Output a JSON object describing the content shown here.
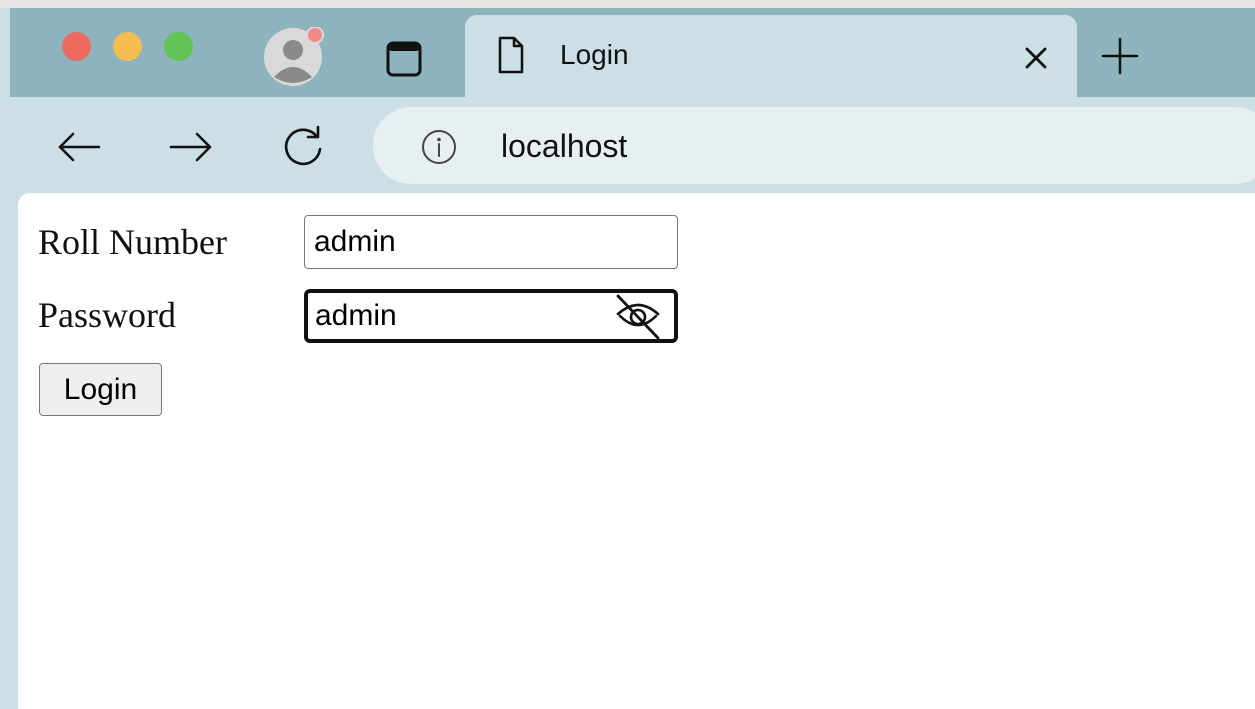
{
  "browser": {
    "tab": {
      "title": "Login"
    },
    "address_bar": {
      "url": "localhost"
    }
  },
  "form": {
    "roll_number": {
      "label": "Roll Number",
      "value": "admin"
    },
    "password": {
      "label": "Password",
      "value": "admin"
    },
    "submit_label": "Login"
  },
  "colors": {
    "tab_bar": "#8db3bd",
    "toolbar": "#ccdfe5",
    "traffic_red": "#ee6a5f",
    "traffic_yellow": "#f5bd4f",
    "traffic_green": "#61c454",
    "profile_badge": "#f08a82"
  }
}
